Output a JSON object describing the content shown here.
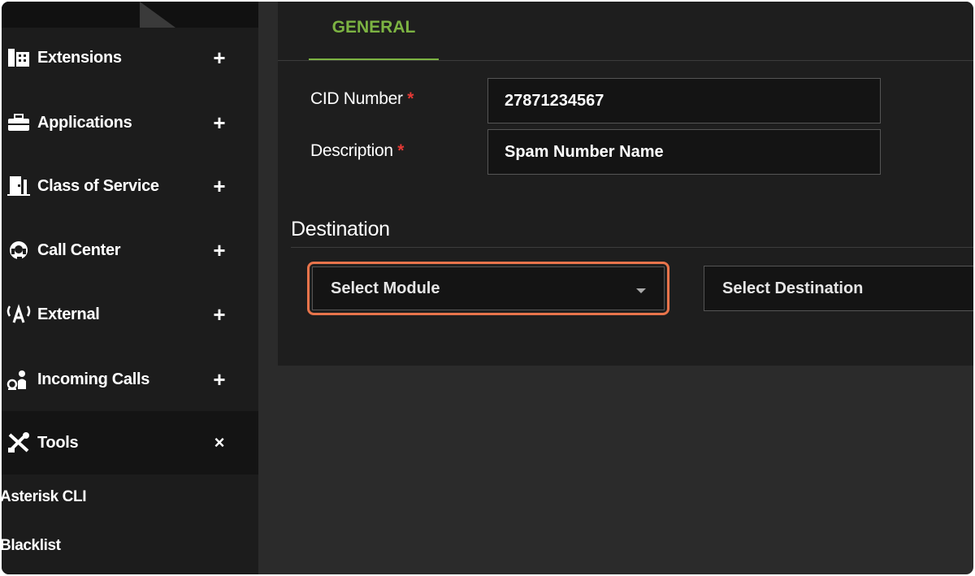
{
  "sidebar": {
    "items": [
      {
        "label": "Extensions",
        "icon": "extensions-icon",
        "toggle": "+"
      },
      {
        "label": "Applications",
        "icon": "applications-icon",
        "toggle": "+"
      },
      {
        "label": "Class of Service",
        "icon": "class-of-service-icon",
        "toggle": "+"
      },
      {
        "label": "Call Center",
        "icon": "headset-icon",
        "toggle": "+"
      },
      {
        "label": "External",
        "icon": "antenna-icon",
        "toggle": "+"
      },
      {
        "label": "Incoming Calls",
        "icon": "incoming-calls-icon",
        "toggle": "+"
      },
      {
        "label": "Tools",
        "icon": "tools-icon",
        "toggle": "×"
      }
    ],
    "sub_items": [
      "Asterisk CLI",
      "Blacklist"
    ]
  },
  "tabs": {
    "general": "GENERAL"
  },
  "form": {
    "cid_label": "CID Number",
    "cid_value": "27871234567",
    "description_label": "Description",
    "description_value": "Spam Number Name",
    "required_mark": "*"
  },
  "destination": {
    "title": "Destination",
    "module_select": "Select Module",
    "destination_select": "Select Destination"
  },
  "colors": {
    "accent": "#7cb342",
    "required": "#e53935",
    "highlight": "#e8744b"
  }
}
